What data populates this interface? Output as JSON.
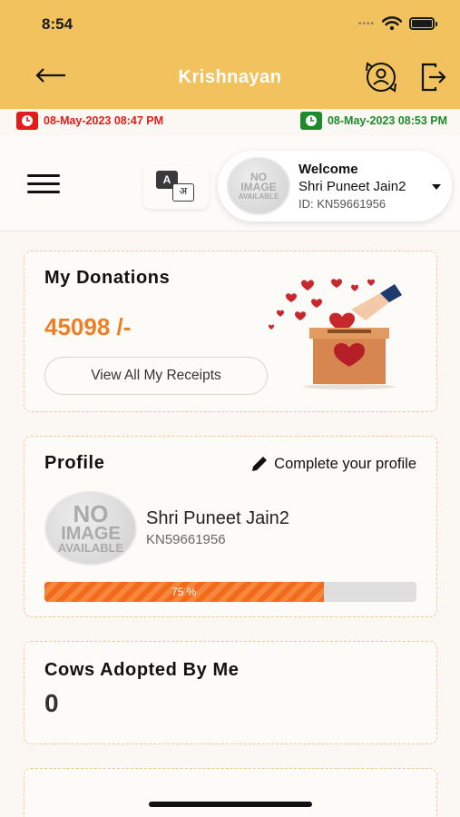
{
  "status_bar": {
    "time": "8:54"
  },
  "app_bar": {
    "title": "Krishnayan",
    "icons": [
      "back-arrow-icon",
      "switch-user-icon",
      "logout-icon"
    ]
  },
  "timestamps": {
    "left": {
      "text": "08-May-2023 08:47 PM",
      "color": "#e21b1b"
    },
    "right": {
      "text": "08-May-2023 08:53 PM",
      "color": "#1d8a2c"
    }
  },
  "language_toggle": {
    "latin": "A",
    "hindi": "अ"
  },
  "user": {
    "welcome_label": "Welcome",
    "name": "Shri Puneet Jain2",
    "id_label": "ID: KN59661956",
    "avatar_text": [
      "NO",
      "IMAGE",
      "AVAILABLE"
    ]
  },
  "donations": {
    "title": "My Donations",
    "amount": "45098 /-",
    "receipts_button": "View All My Receipts"
  },
  "profile": {
    "title": "Profile",
    "complete_link": "Complete your profile",
    "name": "Shri Puneet Jain2",
    "id": "KN59661956",
    "progress_label": "75 %",
    "progress_value": 0.75
  },
  "cows": {
    "title": "Cows Adopted By Me",
    "count": "0"
  },
  "colors": {
    "accent": "#f1c25e",
    "orange": "#f07e25",
    "progress": "#f26a1b"
  }
}
